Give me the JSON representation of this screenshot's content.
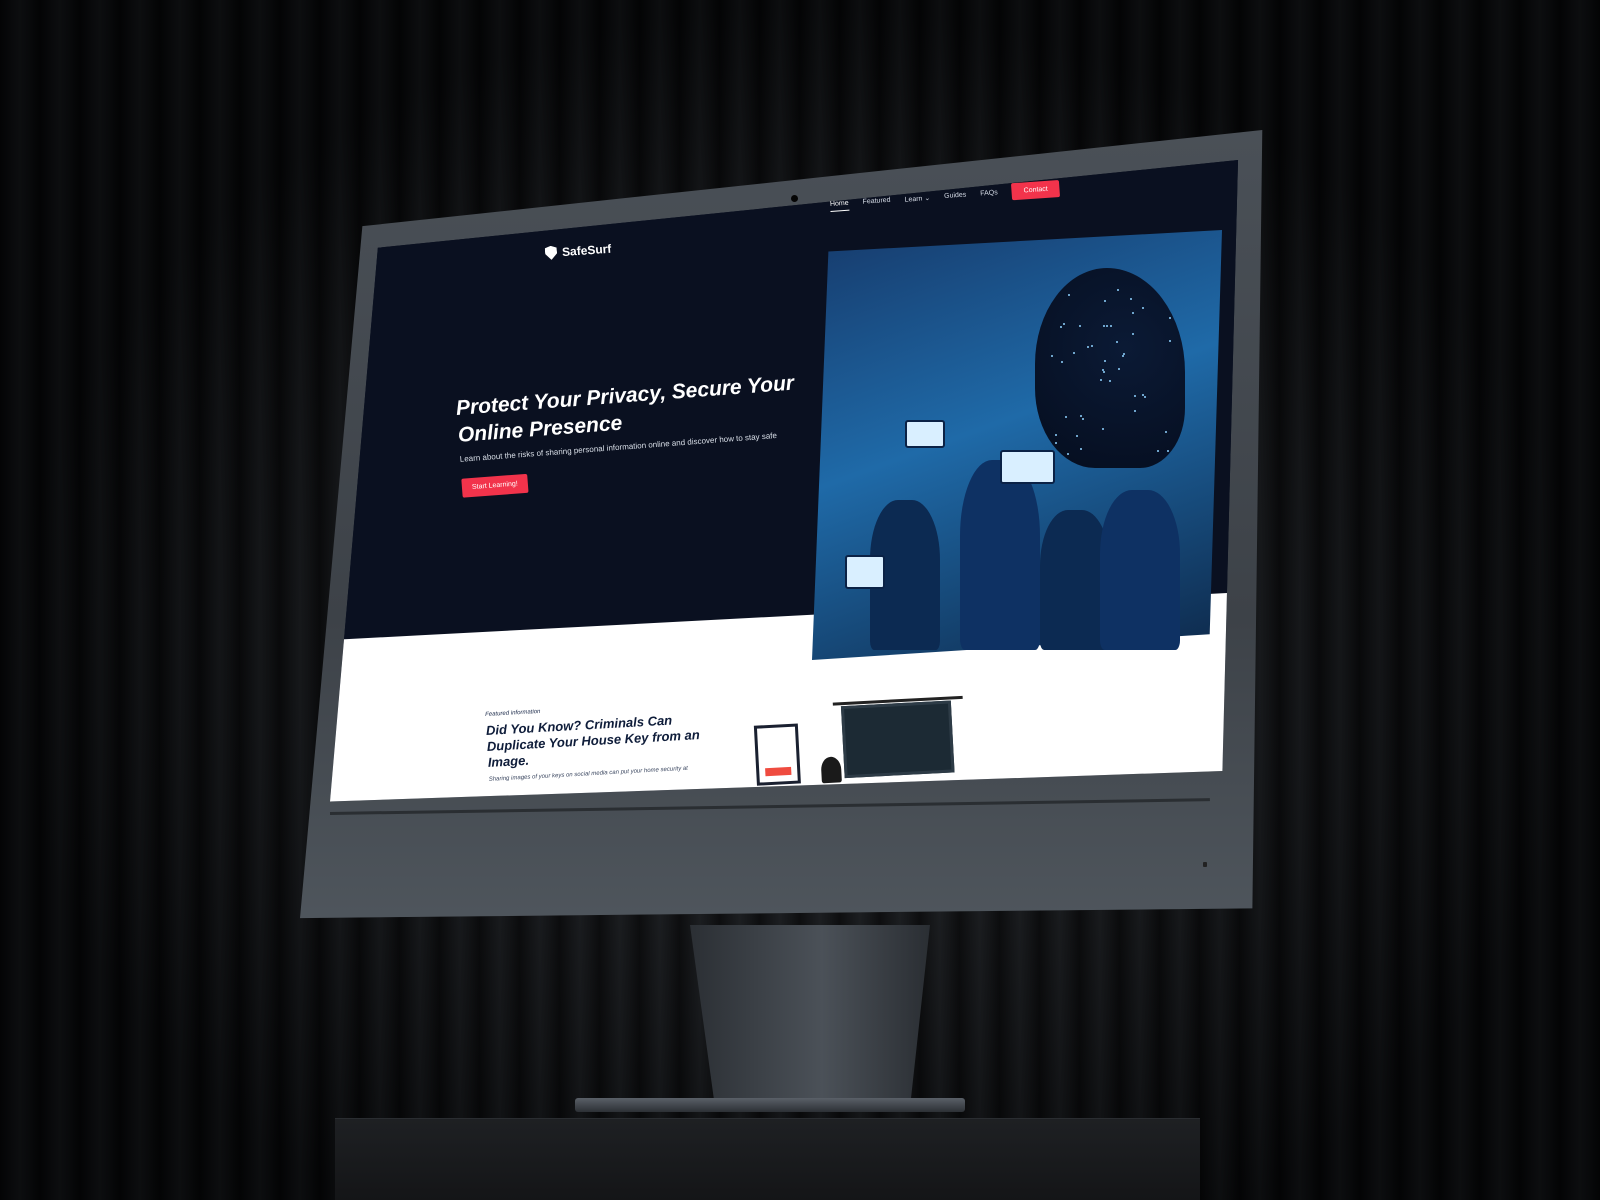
{
  "site": {
    "brand": "SafeSurf",
    "nav": {
      "items": [
        "Home",
        "Featured",
        "Learn ⌄",
        "Guides",
        "FAQs"
      ],
      "active": "Home",
      "contact_label": "Contact"
    },
    "hero": {
      "title": "Protect Your Privacy, Secure Your Online Presence",
      "subtitle": "Learn about the risks of sharing personal information online and discover how to stay safe",
      "cta_label": "Start Learning!"
    },
    "featured": {
      "kicker": "Featured information",
      "title": "Did You Know? Criminals Can Duplicate Your House Key from an Image.",
      "description": "Sharing images of your keys on social media can put your home security at"
    }
  },
  "colors": {
    "hero_bg": "#0a1020",
    "accent": "#f2334b",
    "section_bg": "#ffffff"
  },
  "icons": {
    "logo": "shield-icon"
  }
}
